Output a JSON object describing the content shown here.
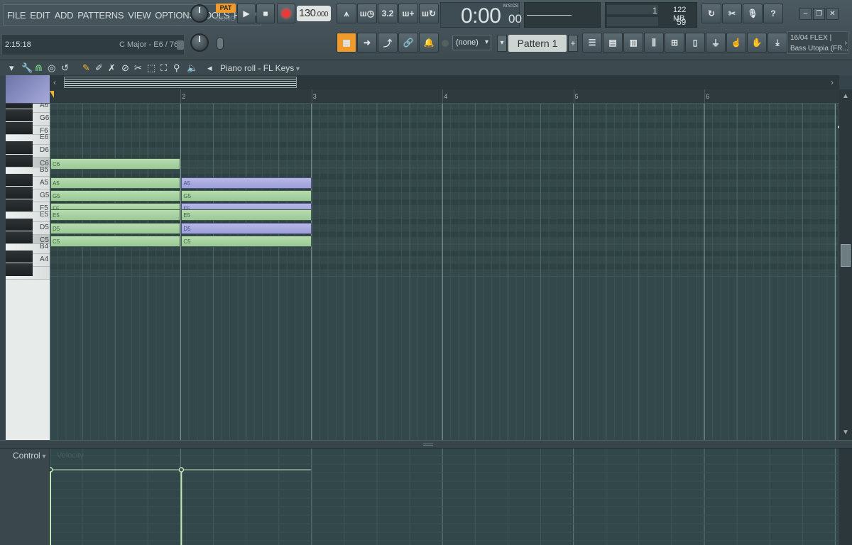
{
  "menu": [
    "FILE",
    "EDIT",
    "ADD",
    "PATTERNS",
    "VIEW",
    "OPTIONS",
    "TOOLS",
    "HELP"
  ],
  "hint": {
    "time": "2:15:18",
    "scale": "C Major - E6 / 76"
  },
  "transport": {
    "pat": "PAT",
    "song": "SONG",
    "tempo_main": "130",
    "tempo_frac": ".000"
  },
  "time": {
    "main": "0:00",
    "sub": "00",
    "label": "M:S:CS"
  },
  "cpu": {
    "poly": "1",
    "mem": "122 MB",
    "cpu": "59"
  },
  "pattern": {
    "channel_filter": "(none)",
    "name": "Pattern 1"
  },
  "plugin": {
    "line1": "16/04  FLEX |",
    "line2": "Bass Utopia (FR..."
  },
  "piano_roll": {
    "title": "Piano roll - FL Keys"
  },
  "ruler": [
    "2",
    "3",
    "4",
    "5",
    "6"
  ],
  "keys": [
    "A6",
    "G6",
    "F6",
    "E6",
    "D6",
    "C6",
    "B5",
    "A5",
    "G5",
    "F5",
    "E5",
    "D5",
    "C5",
    "B4",
    "A4"
  ],
  "notes": [
    {
      "label": "C6",
      "pitch": "C6",
      "start": 0,
      "length": 1,
      "color": "green"
    },
    {
      "label": "A5",
      "pitch": "A5",
      "start": 0,
      "length": 1,
      "color": "green"
    },
    {
      "label": "A5",
      "pitch": "A5",
      "start": 1,
      "length": 1,
      "color": "purple"
    },
    {
      "label": "G5",
      "pitch": "G5",
      "start": 0,
      "length": 1,
      "color": "green"
    },
    {
      "label": "G5",
      "pitch": "G5",
      "start": 1,
      "length": 1,
      "color": "green"
    },
    {
      "label": "F5",
      "pitch": "F5",
      "start": 0,
      "length": 1,
      "color": "green"
    },
    {
      "label": "F5",
      "pitch": "F5",
      "start": 1,
      "length": 1,
      "color": "purple"
    },
    {
      "label": "E5",
      "pitch": "E5",
      "start": 0,
      "length": 1,
      "color": "green"
    },
    {
      "label": "E5",
      "pitch": "E5",
      "start": 1,
      "length": 1,
      "color": "green"
    },
    {
      "label": "D5",
      "pitch": "D5",
      "start": 0,
      "length": 1,
      "color": "green"
    },
    {
      "label": "D5",
      "pitch": "D5",
      "start": 1,
      "length": 1,
      "color": "purple"
    },
    {
      "label": "C5",
      "pitch": "C5",
      "start": 0,
      "length": 1,
      "color": "green"
    },
    {
      "label": "C5",
      "pitch": "C5",
      "start": 1,
      "length": 1,
      "color": "green"
    }
  ],
  "event_editor": {
    "target": "Control",
    "ghost": "Velocity"
  },
  "colors": {
    "note_green": "#b6dcae",
    "note_purple": "#b6b8e6",
    "accent": "#f09a2a",
    "record": "#e83a3a"
  }
}
